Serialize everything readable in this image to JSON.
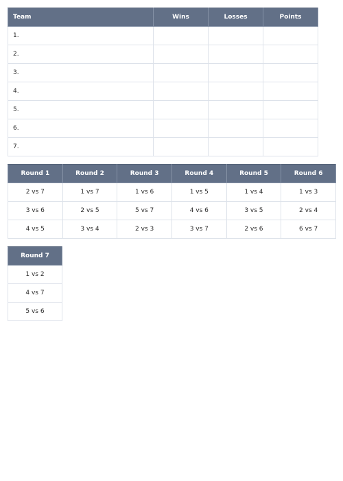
{
  "standings": {
    "headers": [
      "Team",
      "Wins",
      "Losses",
      "Points"
    ],
    "rows": [
      {
        "team": "1.",
        "wins": "",
        "losses": "",
        "points": ""
      },
      {
        "team": "2.",
        "wins": "",
        "losses": "",
        "points": ""
      },
      {
        "team": "3.",
        "wins": "",
        "losses": "",
        "points": ""
      },
      {
        "team": "4.",
        "wins": "",
        "losses": "",
        "points": ""
      },
      {
        "team": "5.",
        "wins": "",
        "losses": "",
        "points": ""
      },
      {
        "team": "6.",
        "wins": "",
        "losses": "",
        "points": ""
      },
      {
        "team": "7.",
        "wins": "",
        "losses": "",
        "points": ""
      }
    ]
  },
  "rounds": {
    "headers": [
      "Round 1",
      "Round 2",
      "Round 3",
      "Round 4",
      "Round 5",
      "Round 6"
    ],
    "rows": [
      [
        "2 vs 7",
        "1 vs 7",
        "1 vs 6",
        "1 vs 5",
        "1 vs 4",
        "1 vs 3"
      ],
      [
        "3 vs 6",
        "2 vs 5",
        "5 vs 7",
        "4 vs 6",
        "3 vs 5",
        "2 vs 4"
      ],
      [
        "4 vs 5",
        "3 vs 4",
        "2 vs 3",
        "3 vs 7",
        "2 vs 6",
        "6 vs 7"
      ]
    ]
  },
  "round7": {
    "header": "Round 7",
    "rows": [
      "1 vs 2",
      "4 vs 7",
      "5 vs 6"
    ]
  },
  "colors": {
    "header_bg": "#627087",
    "header_text": "#ffffff",
    "border": "#dde2ea"
  }
}
